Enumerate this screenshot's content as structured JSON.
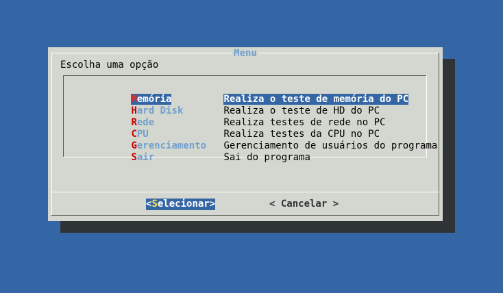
{
  "dialog": {
    "title": "Menu",
    "prompt": "Escolha uma opção"
  },
  "menu": {
    "selected_index": 0,
    "items": [
      {
        "hotkey": "M",
        "rest": "emória",
        "description": "Realiza o teste de memória do PC"
      },
      {
        "hotkey": "H",
        "rest": "ard Disk",
        "description": "Realiza o teste de HD do PC"
      },
      {
        "hotkey": "R",
        "rest": "ede",
        "description": "Realiza testes de rede no PC"
      },
      {
        "hotkey": "C",
        "rest": "PU",
        "description": "Realiza testes da CPU no PC"
      },
      {
        "hotkey": "G",
        "rest": "erenciamento",
        "description": "Gerenciamento de usuários do programa"
      },
      {
        "hotkey": "S",
        "rest": "air",
        "description": "Sai do programa"
      }
    ]
  },
  "buttons": {
    "select": {
      "left": "<",
      "hotkey": "S",
      "rest": "elecionar",
      "right": ">"
    },
    "cancel": {
      "label": "< Cancelar >"
    }
  },
  "colors": {
    "background": "#3465a4",
    "dialog": "#d3d7cf",
    "shadow": "#2e3436",
    "hotkey": "#cc0000",
    "tag": "#729fcf",
    "selection": "#3465a4",
    "selected_hotkey_button": "#fce94f"
  }
}
